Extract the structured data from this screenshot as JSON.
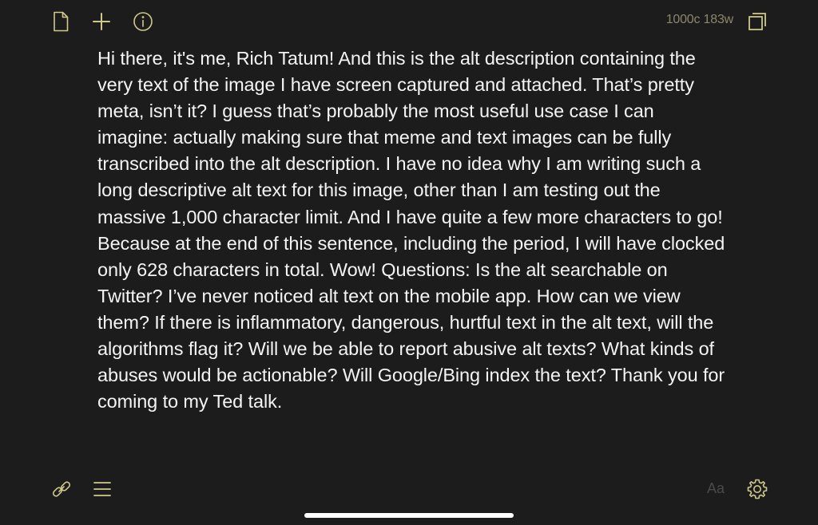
{
  "toolbar": {
    "new_document_icon": "document-icon",
    "add_icon": "plus-icon",
    "info_icon": "info-icon",
    "counter_text": "1000c 183w",
    "fullscreen_icon": "expand-icon"
  },
  "editor": {
    "text": "Hi there, it's me, Rich Tatum! And this is the alt description containing the very text of the image I have screen captured and attached. That’s pretty meta, isn’t it? I guess that’s probably the most useful use case I can imagine: actually making sure that meme and text images can be fully transcribed into the alt description. I have no idea why I am writing such a long descriptive alt text for this image, other than I am testing out the massive 1,000 character limit. And I have quite a few more characters to go! Because at the end of this sentence, including the period, I will have clocked only 628 characters in total. Wow! Questions: Is the alt searchable on Twitter? I’ve never noticed alt text on the mobile app. How can we view them? If there is inflammatory, dangerous, hurtful text in the alt text, will the algorithms flag it? Will we be able to report abusive alt texts? What kinds of abuses would be actionable? Will Google/Bing index the text? Thank you for coming to my Ted talk."
  },
  "bottom_bar": {
    "link_icon": "link-icon",
    "list_icon": "list-icon",
    "font_toggle_label": "Aa",
    "settings_icon": "gear-icon"
  },
  "colors": {
    "background": "#1c1c1c",
    "accent": "#cfc98c",
    "muted": "#8c876a",
    "text": "#f4f4f4",
    "disabled": "#4a4a4a"
  }
}
